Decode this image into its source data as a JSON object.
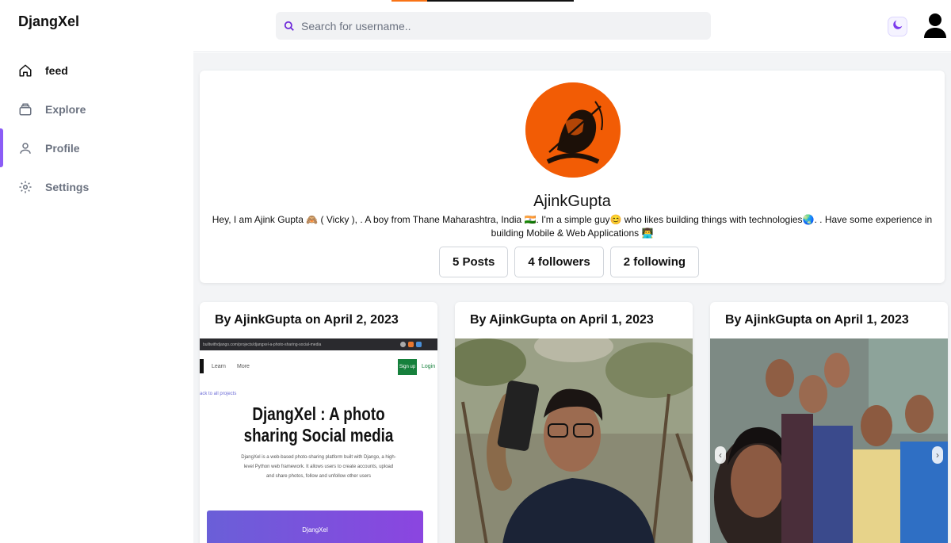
{
  "app": {
    "brand": "DjangXel"
  },
  "sidebar": {
    "items": [
      {
        "label": "feed",
        "icon": "home-icon"
      },
      {
        "label": "Explore",
        "icon": "explore-icon"
      },
      {
        "label": "Profile",
        "icon": "user-icon"
      },
      {
        "label": "Settings",
        "icon": "gear-icon"
      }
    ]
  },
  "search": {
    "placeholder": "Search for username.."
  },
  "profile": {
    "username": "AjinkGupta",
    "bio": "Hey, I am Ajink Gupta 🙈 ( Vicky ), . A boy from Thane Maharashtra, India 🇮🇳. I'm a simple guy😊 who likes building things with technologies🌏. . Have some experience in building Mobile & Web Applications 👨‍💻",
    "stats": {
      "posts": "5 Posts",
      "followers": "4 followers",
      "following": "2 following"
    }
  },
  "posts": [
    {
      "title": "By AjinkGupta on April 2, 2023",
      "screenshot": {
        "url": "builtwithdjango.com/projects/djangxel-a-photo-sharing-social-media",
        "learn": "Learn",
        "more": "More",
        "signup": "Sign up",
        "login": "Login",
        "back": "ack to all projects",
        "heading_line1": "DjangXel : A photo",
        "heading_line2": "sharing Social media",
        "desc": "DjangXel is a web-based photo-sharing platform built with Django, a high-level Python web framework. It allows users to create accounts, upload and share photos, follow and unfollow other users",
        "banner": "DjangXel"
      }
    },
    {
      "title": "By AjinkGupta on April 1, 2023"
    },
    {
      "title": "By AjinkGupta on April 1, 2023"
    }
  ],
  "colors": {
    "accent": "#8b5cf6",
    "avatar_bg": "#f25c05",
    "main_bg": "#f3f4f6"
  }
}
